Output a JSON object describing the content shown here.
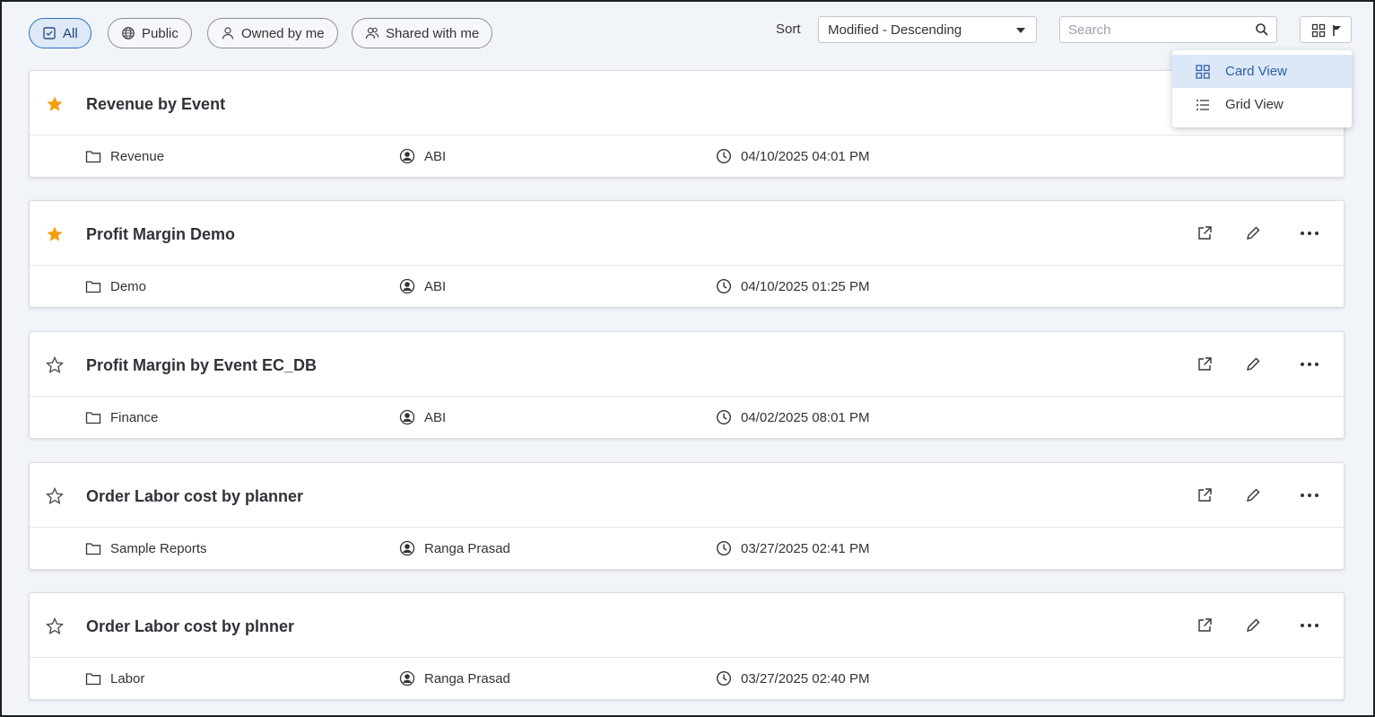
{
  "filters": {
    "all": "All",
    "public": "Public",
    "owned": "Owned by me",
    "shared": "Shared with me"
  },
  "sort": {
    "label": "Sort",
    "value": "Modified - Descending"
  },
  "search": {
    "placeholder": "Search"
  },
  "view_menu": {
    "card": "Card View",
    "grid": "Grid View"
  },
  "colors": {
    "accent": "#2f6fc0",
    "star": "#f59e0b"
  },
  "items": [
    {
      "title": "Revenue by Event",
      "folder": "Revenue",
      "owner": "ABI",
      "modified": "04/10/2025 04:01 PM",
      "favorite": true
    },
    {
      "title": "Profit Margin Demo",
      "folder": "Demo",
      "owner": "ABI",
      "modified": "04/10/2025 01:25 PM",
      "favorite": true
    },
    {
      "title": "Profit Margin by Event EC_DB",
      "folder": "Finance",
      "owner": "ABI",
      "modified": "04/02/2025 08:01 PM",
      "favorite": false
    },
    {
      "title": "Order Labor cost by planner",
      "folder": "Sample Reports",
      "owner": "Ranga Prasad",
      "modified": "03/27/2025 02:41 PM",
      "favorite": false
    },
    {
      "title": "Order Labor cost by plnner",
      "folder": "Labor",
      "owner": "Ranga Prasad",
      "modified": "03/27/2025 02:40 PM",
      "favorite": false
    }
  ]
}
